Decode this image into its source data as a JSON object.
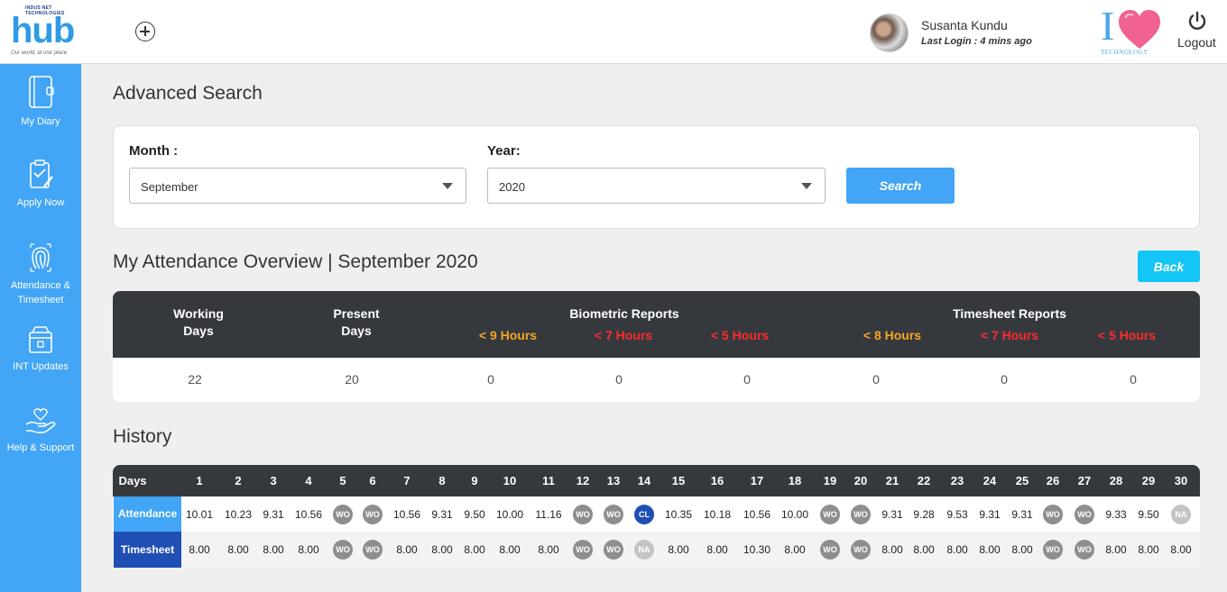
{
  "header": {
    "logo_tiny": "INDUS NET TECHNOLOGIES",
    "logo_text": "hub",
    "logo_tagline": "Our world, at one place",
    "user_name": "Susanta Kundu",
    "last_login": "Last Login : 4 mins ago",
    "brand_tag": "TECHNOLOGY",
    "logout_label": "Logout"
  },
  "sidebar": {
    "items": [
      {
        "label": "My Diary",
        "icon": "diary-icon"
      },
      {
        "label": "Apply Now",
        "icon": "clipboard-check-icon"
      },
      {
        "label": "Attendance & Timesheet",
        "icon": "fingerprint-icon"
      },
      {
        "label": "INT Updates",
        "icon": "box-icon"
      },
      {
        "label": "Help & Support",
        "icon": "hand-heart-icon"
      }
    ]
  },
  "search": {
    "title": "Advanced Search",
    "month_label": "Month :",
    "month_value": "September",
    "year_label": "Year:",
    "year_value": "2020",
    "search_button": "Search"
  },
  "overview": {
    "title": "My Attendance Overview | September 2020",
    "back_button": "Back",
    "working_days_label": "Working Days",
    "present_days_label": "Present Days",
    "biometric_label": "Biometric Reports",
    "timesheet_label": "Timesheet Reports",
    "sub_labels": [
      "< 9 Hours",
      "< 7 Hours",
      "< 5 Hours",
      "< 8 Hours",
      "< 7 Hours",
      "< 5 Hours"
    ],
    "values": [
      "22",
      "20",
      "0",
      "0",
      "0",
      "0",
      "0",
      "0"
    ],
    "colors": {
      "orange": "#f5a623",
      "red": "#ff2a2a"
    }
  },
  "history": {
    "title": "History",
    "days_label": "Days",
    "days": [
      "1",
      "2",
      "3",
      "4",
      "5",
      "6",
      "7",
      "8",
      "9",
      "10",
      "11",
      "12",
      "13",
      "14",
      "15",
      "16",
      "17",
      "18",
      "19",
      "20",
      "21",
      "22",
      "23",
      "24",
      "25",
      "26",
      "27",
      "28",
      "29",
      "30"
    ],
    "attendance_label": "Attendance",
    "timesheet_label": "Timesheet",
    "attendance": [
      "10.01",
      "10.23",
      "9.31",
      "10.56",
      "WO",
      "WO",
      "10.56",
      "9.31",
      "9.50",
      "10.00",
      "11.16",
      "WO",
      "WO",
      "CL",
      "10.35",
      "10.18",
      "10.56",
      "10.00",
      "WO",
      "WO",
      "9.31",
      "9.28",
      "9.53",
      "9.31",
      "9.31",
      "WO",
      "WO",
      "9.33",
      "9.50",
      "NA"
    ],
    "timesheet": [
      "8.00",
      "8.00",
      "8.00",
      "8.00",
      "WO",
      "WO",
      "8.00",
      "8.00",
      "8.00",
      "8.00",
      "8.00",
      "WO",
      "WO",
      "NA",
      "8.00",
      "8.00",
      "10.30",
      "8.00",
      "WO",
      "WO",
      "8.00",
      "8.00",
      "8.00",
      "8.00",
      "8.00",
      "WO",
      "WO",
      "8.00",
      "8.00",
      "8.00"
    ],
    "colors": {
      "attendance_label_bg": "#42a5f5",
      "timesheet_label_bg": "#1f4fb5",
      "wo": "#8e8e8e",
      "cl": "#1f4fb5",
      "na": "#c4c4c4"
    }
  }
}
